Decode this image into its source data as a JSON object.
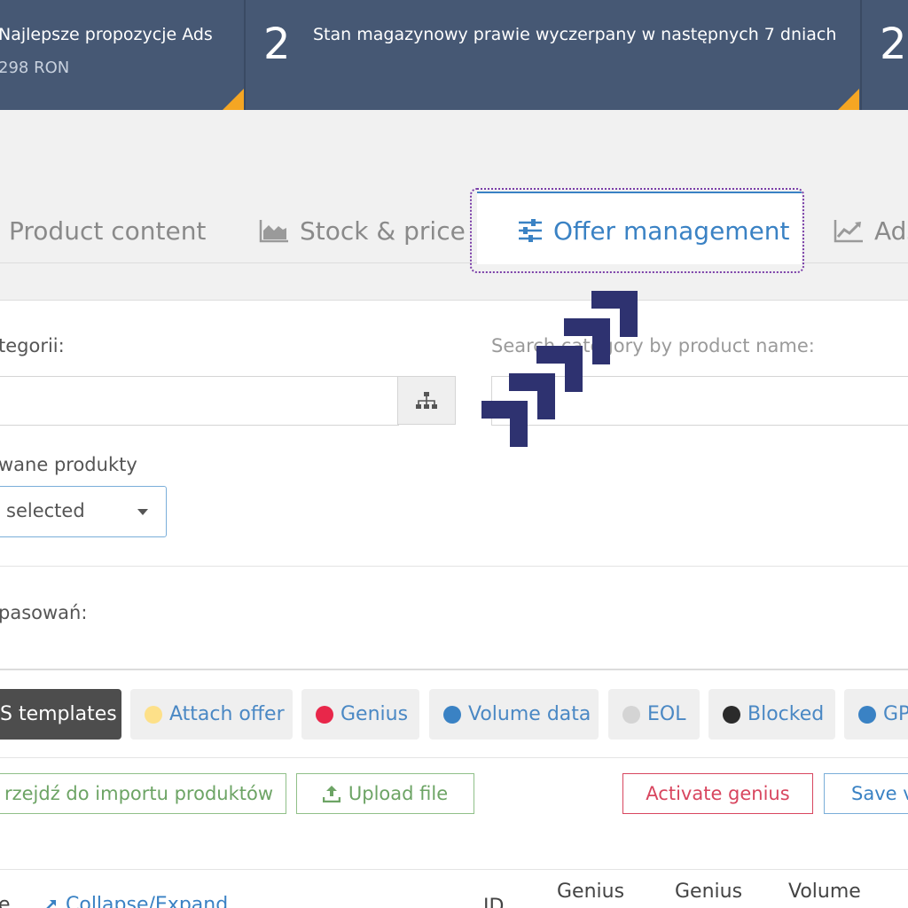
{
  "banner": {
    "cards": [
      {
        "number": "",
        "title": "Najlepsze propozycje Ads",
        "subtitle": "298 RON"
      },
      {
        "number": "2",
        "title": "Stan magazynowy prawie wyczerpany w następnych 7 dniach",
        "subtitle": ""
      },
      {
        "number": "2",
        "title": "",
        "subtitle": ""
      }
    ],
    "accent_color": "#f5a623",
    "background_color": "#465874"
  },
  "tabs": [
    {
      "label": "Product content",
      "icon": "none",
      "active": false
    },
    {
      "label": "Stock & price",
      "icon": "area-chart-icon",
      "active": false
    },
    {
      "label": "Offer management",
      "icon": "sliders-icon",
      "active": true
    },
    {
      "label": "Ads",
      "icon": "line-chart-icon",
      "active": false
    }
  ],
  "form": {
    "category_label": "tegorii:",
    "category_value": "",
    "search_label": "Search category by product name:",
    "search_value": "",
    "products_label": "wane produkty",
    "products_select": "selected",
    "matches_label": "pasowań:"
  },
  "filters": [
    {
      "label": "S templates",
      "dot_color": "",
      "dark": true
    },
    {
      "label": "Attach offer",
      "dot_color": "#fde089"
    },
    {
      "label": "Genius",
      "dot_color": "#e8274a"
    },
    {
      "label": "Volume data",
      "dot_color": "#3a82c4"
    },
    {
      "label": "EOL",
      "dot_color": "#d4d4d4"
    },
    {
      "label": "Blocked",
      "dot_color": "#2b2b2b"
    },
    {
      "label": "GP",
      "dot_color": "#3a82c4"
    }
  ],
  "actions": {
    "import_label": "rzejdź do importu produktów",
    "upload_label": "Upload file",
    "genius_label": "Activate genius",
    "save_label": "Save v"
  },
  "table": {
    "collapse_label": "Collapse/Expand",
    "col_e": "e",
    "col_id": "ID",
    "col_genius_1": "Genius",
    "col_genius_2": "Genius",
    "col_volume": "Volume"
  }
}
